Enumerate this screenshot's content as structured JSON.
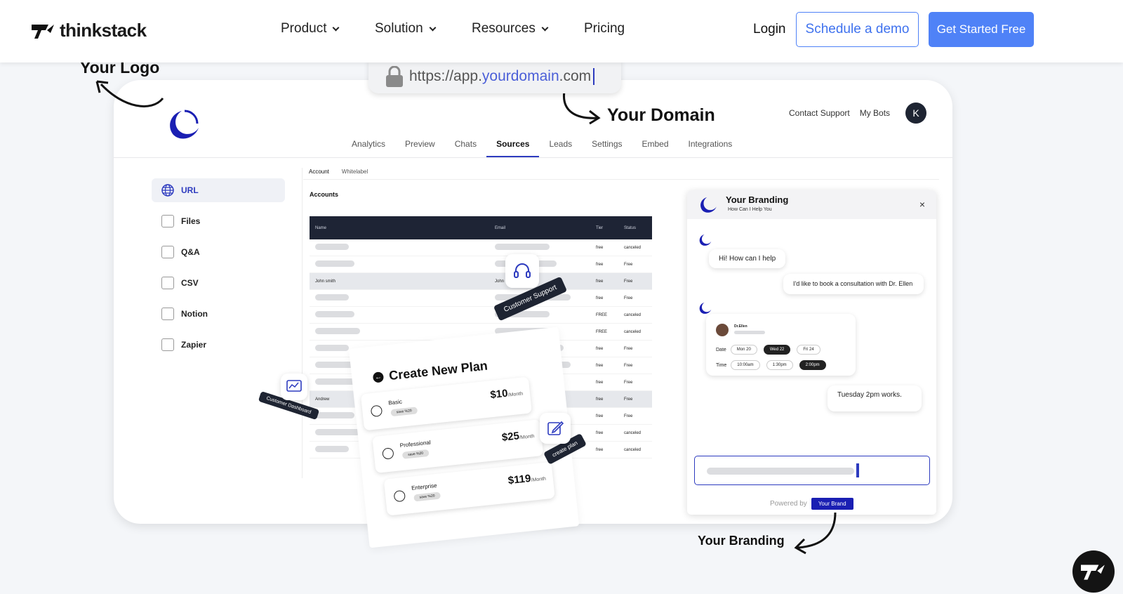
{
  "nav": {
    "brand": "thinkstack",
    "items": [
      {
        "label": "Product",
        "dropdown": true
      },
      {
        "label": "Solution",
        "dropdown": true
      },
      {
        "label": "Resources",
        "dropdown": true
      },
      {
        "label": "Pricing",
        "dropdown": false
      }
    ],
    "login": "Login",
    "demo": "Schedule a demo",
    "start": "Get Started Free"
  },
  "hero": {
    "your_logo": "Your Logo",
    "url_prefix": "https://app.",
    "url_domain": "yourdomain",
    "url_suffix": ".com",
    "your_domain": "Your Domain",
    "your_branding": "Your Branding"
  },
  "app": {
    "top_links": [
      "Contact Support",
      "My Bots"
    ],
    "avatar": "K",
    "tabs": [
      "Analytics",
      "Preview",
      "Chats",
      "Sources",
      "Leads",
      "Settings",
      "Embed",
      "Integrations"
    ],
    "active_tab": "Sources",
    "sidebar": [
      "URL",
      "Files",
      "Q&A",
      "CSV",
      "Notion",
      "Zapier"
    ],
    "subtabs": [
      "Account",
      "Whitelabel"
    ],
    "accounts_title": "Accounts",
    "table": {
      "headers": [
        "Name",
        "Email",
        "Tier",
        "Status"
      ],
      "rows": [
        {
          "name": "",
          "email": "",
          "tier": "free",
          "status": "canceled"
        },
        {
          "name": "",
          "email": "",
          "tier": "free",
          "status": "Free"
        },
        {
          "name": "John smith",
          "email": "John",
          "tier": "free",
          "status": "Free"
        },
        {
          "name": "",
          "email": "",
          "tier": "free",
          "status": "Free"
        },
        {
          "name": "",
          "email": "",
          "tier": "FREE",
          "status": "canceled"
        },
        {
          "name": "",
          "email": "",
          "tier": "FREE",
          "status": "canceled"
        },
        {
          "name": "",
          "email": "",
          "tier": "free",
          "status": "Free"
        },
        {
          "name": "",
          "email": "",
          "tier": "free",
          "status": "Free"
        },
        {
          "name": "",
          "email": "",
          "tier": "free",
          "status": "Free"
        },
        {
          "name": "Andrew",
          "email": "com",
          "tier": "free",
          "status": "Free"
        },
        {
          "name": "",
          "email": "",
          "tier": "free",
          "status": "Free"
        },
        {
          "name": "",
          "email": "",
          "tier": "free",
          "status": "canceled"
        },
        {
          "name": "",
          "email": "",
          "tier": "free",
          "status": "canceled"
        }
      ]
    }
  },
  "widget": {
    "title": "Your Branding",
    "subtitle": "How Can I Help You",
    "close": "×",
    "msg1": "Hi! How can I help",
    "msg2": "I'd like to book a consultation with Dr. Ellen",
    "doctor": "Dr.Ellen",
    "date_label": "Date",
    "dates": [
      "Mon 20",
      "Wed 22",
      "Fri 24"
    ],
    "time_label": "Time",
    "times": [
      "10:00am",
      "1:30pm",
      "2:00pm"
    ],
    "msg3": "Tuesday 2pm works.",
    "powered_by": "Powered by",
    "brand_pill": "Your Brand"
  },
  "plan": {
    "title": "Create New Plan",
    "plans": [
      {
        "name": "Basic",
        "save": "save %20",
        "price": "$10",
        "per": "/Month"
      },
      {
        "name": "Professional",
        "save": "save %20",
        "price": "$25",
        "per": "/Month"
      },
      {
        "name": "Enterprise",
        "save": "save %20",
        "price": "$119",
        "per": "/Month"
      }
    ]
  },
  "tags": {
    "support": "Customer Support",
    "dashboard": "Customer Dashboard",
    "create": "create plan"
  },
  "colors": {
    "accent": "#4f82f7",
    "brand_blue": "#2d3bbf",
    "dark": "#1e2432"
  }
}
